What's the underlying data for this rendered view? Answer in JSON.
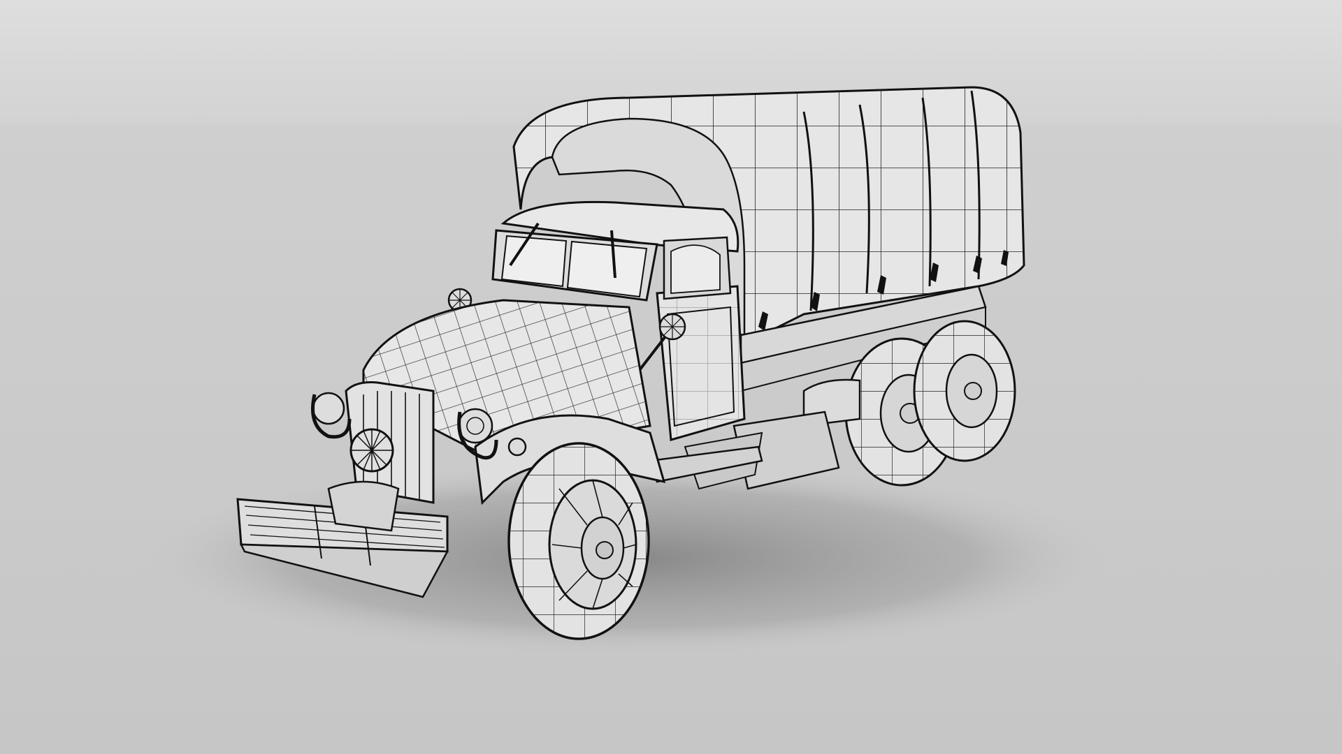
{
  "scene": {
    "subject": "wireframe-military-cargo-truck-6x6",
    "render_style": "grey-shaded-with-wireframe-overlay",
    "view": "three-quarter-front-left",
    "colors": {
      "background_top": "#d6d6d6",
      "floor": "#c8c8c8",
      "model_surface": "#e9e9e9",
      "model_shade": "#bdbdbd",
      "wire": "#1a1a1a",
      "shadow": "#8f8f8f"
    }
  }
}
